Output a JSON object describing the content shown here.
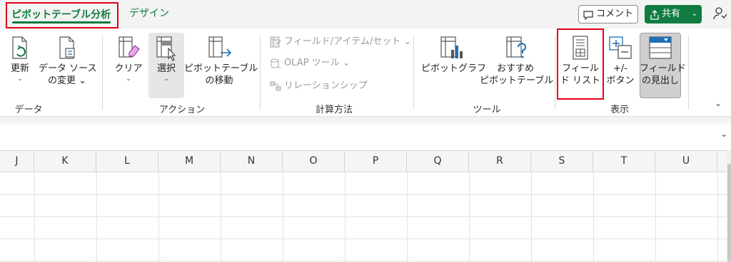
{
  "tabs": {
    "active": "ピボットテーブル分析",
    "design": "デザイン"
  },
  "header_buttons": {
    "comment": "コメント",
    "share": "共有"
  },
  "groups": {
    "data": {
      "label": "データ",
      "refresh": "更新",
      "change_source_line1": "データ ソース",
      "change_source_line2": "の変更 ⌄"
    },
    "action": {
      "label": "アクション",
      "clear": "クリア",
      "select": "選択",
      "move_line1": "ピボットテーブル",
      "move_line2": "の移動"
    },
    "calc": {
      "label": "計算方法",
      "fields_items": "フィールド/アイテム/セット ⌄",
      "olap": "OLAP ツール ⌄",
      "relationships": "リレーションシップ"
    },
    "tools": {
      "label": "ツール",
      "pivotchart": "ピボットグラフ",
      "recommended_line1": "おすすめ",
      "recommended_line2": "ピボットテーブル"
    },
    "show": {
      "label": "表示",
      "field_list_line1": "フィール",
      "field_list_line2": "ド リスト",
      "plus_minus_line1": "+/-",
      "plus_minus_line2": "ボタン",
      "field_headers_line1": "フィールド",
      "field_headers_line2": "の見出し"
    }
  },
  "columns": [
    "J",
    "K",
    "L",
    "M",
    "N",
    "O",
    "P",
    "Q",
    "R",
    "S",
    "T",
    "U"
  ],
  "colors": {
    "accent_green": "#107c41",
    "highlight_red": "#e0001b"
  }
}
